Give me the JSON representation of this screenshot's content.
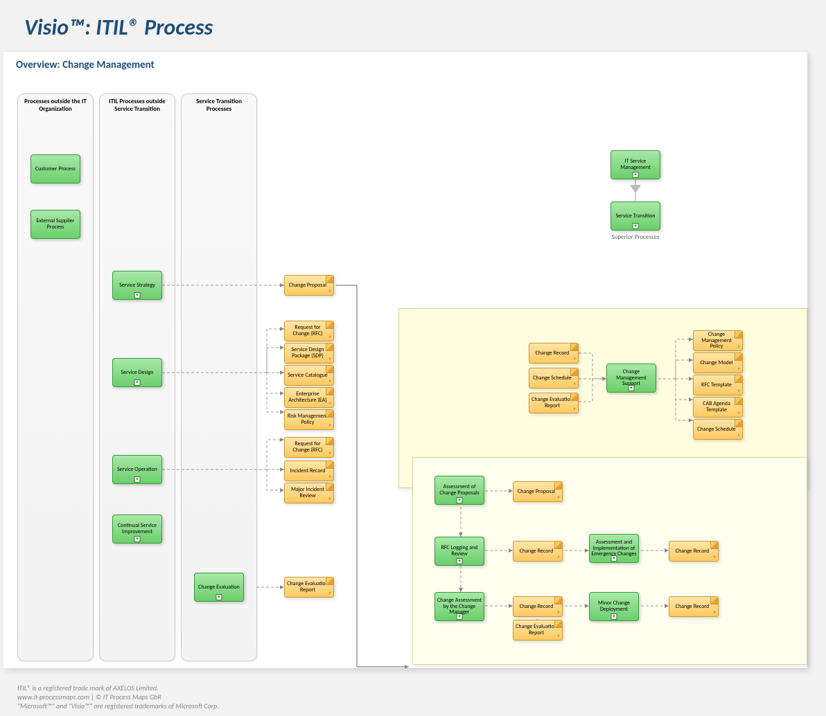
{
  "title": "Visio™: ITIL® Process",
  "subtitle": "Overview: Change Management",
  "lanes": {
    "l1": "Processes outside the IT Organization",
    "l2": "ITIL Processes outside Service Transition",
    "l3": "Service Transition Processes"
  },
  "procs": {
    "cust": "Customer Process",
    "ext": "External Supplier Process",
    "sstrat": "Service Strategy",
    "sdes": "Service Design",
    "sop": "Service Operation",
    "csi": "Continual Service Improvement",
    "ceval": "Change Evaluation",
    "itsm": "IT Service Management",
    "strans": "Service Transition",
    "cms": "Change Management Support",
    "acp": "Assessment of Change Proposals",
    "rfclog": "RFC Logging and Review",
    "aiec": "Assessment and Implementation of Emergency Changes",
    "cacm": "Change Assessment by the Change Manager",
    "mcd": "Minor Change Deployment"
  },
  "docs": {
    "cprop": "Change Proposal",
    "rfc": "Request for Change (RFC)",
    "sdp": "Service Design Package (SDP)",
    "scat": "Service Catalogue",
    "ea": "Enterprise Architecture (EA)",
    "rmp": "Risk Management Policy",
    "rfc2": "Request for Change (RFC)",
    "irec": "Incident Record",
    "mir": "Major Incident Review",
    "cer": "Change Evaluation Report",
    "crec": "Change Record",
    "csch": "Change Schedule",
    "cer2": "Change Evaluation Report",
    "cmp": "Change Management Policy",
    "cmod": "Change Model",
    "rfct": "RFC Template",
    "cat": "CAB Agenda Template",
    "csch2": "Change Schedule",
    "cprop2": "Change Proposal",
    "crec2": "Change Record",
    "crec3": "Change Record",
    "crec4": "Change Record",
    "cer3": "Change Evaluation Report",
    "crec5": "Change Record"
  },
  "superLabel": "Superior Processes",
  "footer": {
    "l1": "ITIL® is a registered trade mark of AXELOS Limited.",
    "l2": "www.it-processmaps.com | © IT Process Maps GbR",
    "l3": "\"Microsoft™\" and \"Visio™\" are registered trademarks of Microsoft Corp."
  }
}
